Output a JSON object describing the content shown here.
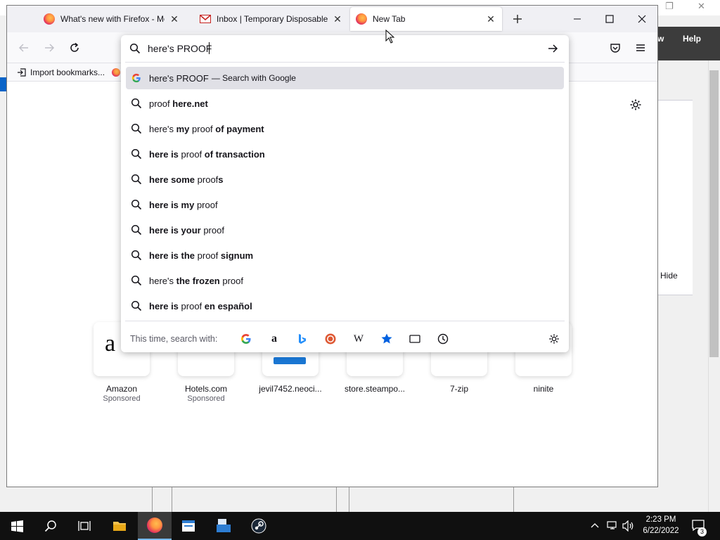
{
  "tabs": [
    {
      "title": "What's new with Firefox - More"
    },
    {
      "title": "Inbox | Temporary Disposable G"
    },
    {
      "title": "New Tab"
    }
  ],
  "bookmarks": {
    "import_label": "Import bookmarks..."
  },
  "background_app": {
    "menu_partial": "w",
    "menu_help": "Help",
    "hide_label": "Hide"
  },
  "urlbar": {
    "value": "here's PROOF",
    "suggestions": [
      {
        "parts": [
          [
            "n",
            "here's PROOF"
          ]
        ],
        "action": "— Search with Google",
        "icon": "google-icon",
        "selected": true
      },
      {
        "parts": [
          [
            "n",
            "proof "
          ],
          [
            "b",
            "here.net"
          ]
        ],
        "icon": "search-icon"
      },
      {
        "parts": [
          [
            "n",
            "here's "
          ],
          [
            "b",
            "my "
          ],
          [
            "n",
            "proof "
          ],
          [
            "b",
            "of payment"
          ]
        ],
        "icon": "search-icon"
      },
      {
        "parts": [
          [
            "b",
            "here is "
          ],
          [
            "n",
            "proof "
          ],
          [
            "b",
            "of transaction"
          ]
        ],
        "icon": "search-icon"
      },
      {
        "parts": [
          [
            "b",
            "here some "
          ],
          [
            "n",
            "proof"
          ],
          [
            "b",
            "s"
          ]
        ],
        "icon": "search-icon"
      },
      {
        "parts": [
          [
            "b",
            "here is my "
          ],
          [
            "n",
            "proof"
          ]
        ],
        "icon": "search-icon"
      },
      {
        "parts": [
          [
            "b",
            "here is your "
          ],
          [
            "n",
            "proof"
          ]
        ],
        "icon": "search-icon"
      },
      {
        "parts": [
          [
            "b",
            "here is the "
          ],
          [
            "n",
            "proof "
          ],
          [
            "b",
            "signum"
          ]
        ],
        "icon": "search-icon"
      },
      {
        "parts": [
          [
            "n",
            "here's "
          ],
          [
            "b",
            "the frozen "
          ],
          [
            "n",
            "proof"
          ]
        ],
        "icon": "search-icon"
      },
      {
        "parts": [
          [
            "b",
            "here is "
          ],
          [
            "n",
            "proof "
          ],
          [
            "b",
            "en español"
          ]
        ],
        "icon": "search-icon"
      }
    ],
    "oneoff_label": "This time, search with:",
    "engines": [
      "google-icon",
      "amazon-icon",
      "bing-icon",
      "duckduckgo-icon",
      "wikipedia-icon",
      "bookmarks-star-icon",
      "tabs-icon",
      "history-clock-icon"
    ]
  },
  "top_sites": [
    {
      "label": "Amazon",
      "sub": "Sponsored"
    },
    {
      "label": "Hotels.com",
      "sub": "Sponsored"
    },
    {
      "label": "jevil7452.neoci...",
      "sub": ""
    },
    {
      "label": "store.steampo...",
      "sub": ""
    },
    {
      "label": "7-zip",
      "sub": ""
    },
    {
      "label": "ninite",
      "sub": ""
    }
  ],
  "taskbar": {
    "time": "2:23 PM",
    "date": "6/22/2022",
    "notification_count": "3"
  },
  "colors": {
    "accent": "#0061e0",
    "selected_row": "#e0e0e6",
    "taskbar": "#101010"
  }
}
